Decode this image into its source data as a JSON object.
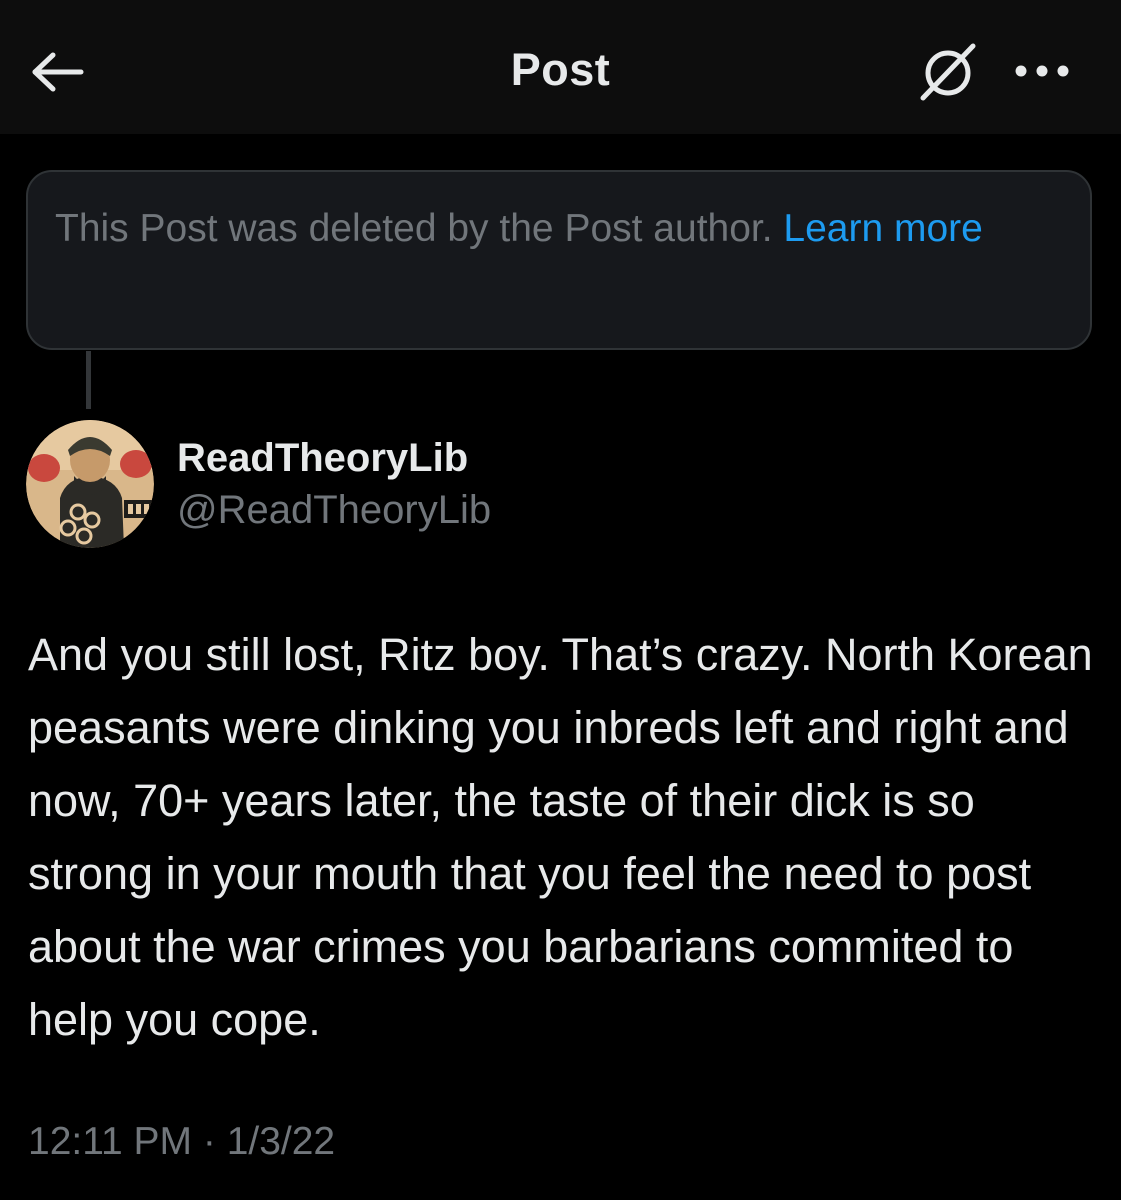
{
  "header": {
    "title": "Post",
    "back_icon": "arrow-left-icon",
    "no_signal_icon": "circle-slash-icon",
    "more_icon": "ellipsis-horizontal-icon"
  },
  "deleted_notice": {
    "text": "This Post was deleted by the Post author. ",
    "link": "Learn more"
  },
  "post": {
    "author": {
      "display_name": "ReadTheoryLib",
      "handle": "@ReadTheoryLib"
    },
    "text": "And you still lost, Ritz boy. That’s crazy. North Korean peasants were dinking you inbreds left and right and now, 70+ years later, the taste of their dick is so strong in your mouth that you feel the need to post about the war crimes you barbarians commited to help you cope.",
    "timestamp": "12:11 PM · 1/3/22"
  },
  "colors": {
    "background": "#000000",
    "header_background": "#0d0d0d",
    "primary_text": "#e7e9ea",
    "secondary_text": "#71767b",
    "link": "#1d9bf0",
    "card_background": "#16181c",
    "card_border": "#2f3336"
  }
}
